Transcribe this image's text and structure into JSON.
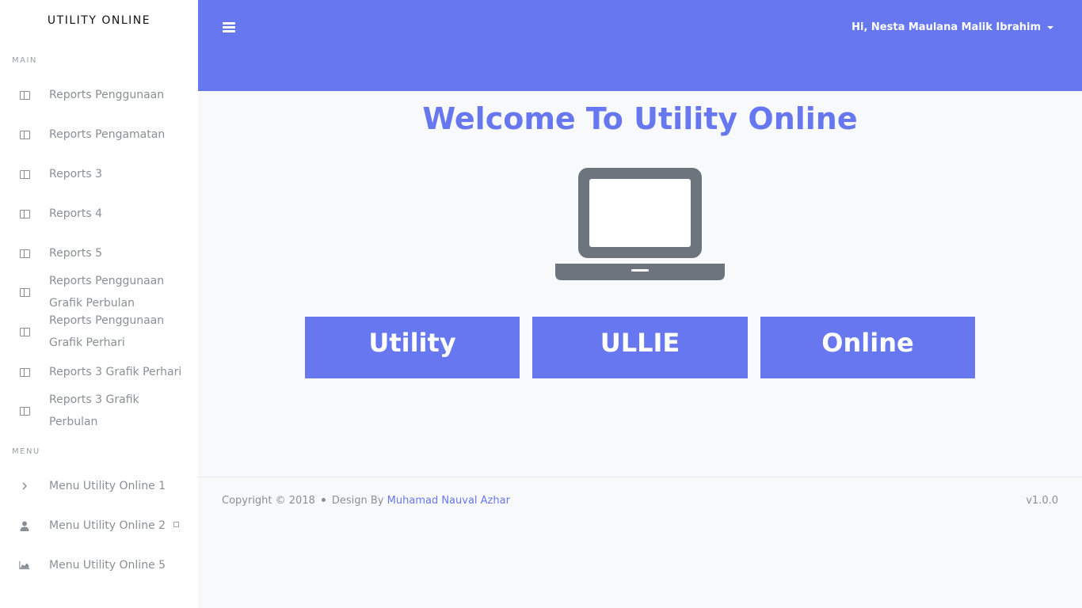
{
  "brand": "UTILITY ONLINE",
  "sidebar": {
    "main_label": "MAIN",
    "menu_label": "MENU",
    "main_items": [
      {
        "line1": "Reports Penggunaan",
        "line2": ""
      },
      {
        "line1": "Reports Pengamatan",
        "line2": ""
      },
      {
        "line1": "Reports 3",
        "line2": ""
      },
      {
        "line1": "Reports 4",
        "line2": ""
      },
      {
        "line1": "Reports 5",
        "line2": ""
      },
      {
        "line1": "Reports Penggunaan",
        "line2": "Grafik Perbulan"
      },
      {
        "line1": "Reports Penggunaan",
        "line2": "Grafik Perhari"
      },
      {
        "line1": "Reports 3 Grafik Perhari",
        "line2": ""
      },
      {
        "line1": "Reports 3 Grafik",
        "line2": "Perbulan"
      }
    ],
    "menu_items": [
      {
        "label": "Menu Utility Online 1",
        "icon": "chevron-right-icon"
      },
      {
        "label": "Menu Utility Online 2",
        "icon": "user-icon"
      },
      {
        "label": "Menu Utility Online 5",
        "icon": "area-chart-icon"
      }
    ]
  },
  "header": {
    "user_greeting": "Hi, Nesta Maulana Malik Ibrahim"
  },
  "main": {
    "welcome": "Welcome To Utility Online",
    "buttons": [
      "Utility",
      "ULLIE",
      "Online"
    ]
  },
  "footer": {
    "copyright": "Copyright © 2018",
    "design_by": "Design By",
    "author": "Muhamad Nauval Azhar",
    "version": "v1.0.0"
  },
  "colors": {
    "primary": "#6777ef",
    "icon_gray": "#6c757d"
  }
}
